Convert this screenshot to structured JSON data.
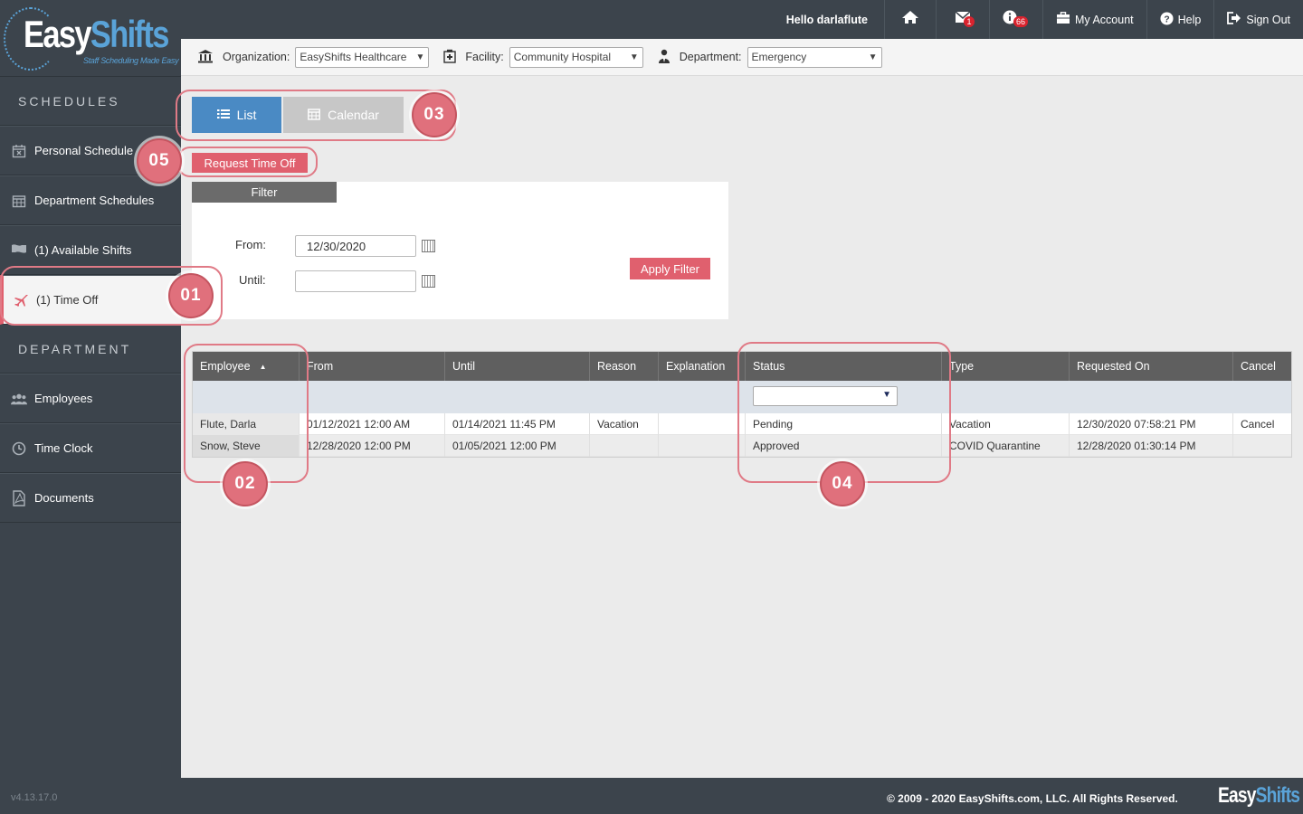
{
  "logo": {
    "word1": "Easy",
    "word2": "Shifts",
    "tagline": "Staff Scheduling Made Easy"
  },
  "sidebar": {
    "sections": [
      {
        "title": "SCHEDULES",
        "items": [
          {
            "label": "Personal Schedule",
            "icon": "calendar-x-icon"
          },
          {
            "label": "Department Schedules",
            "icon": "calendar-grid-icon"
          },
          {
            "label": "(1) Available Shifts",
            "icon": "flag-icon"
          },
          {
            "label": "(1) Time Off",
            "icon": "airplane-icon",
            "active": true
          }
        ]
      },
      {
        "title": "DEPARTMENT",
        "items": [
          {
            "label": "Employees",
            "icon": "users-icon"
          },
          {
            "label": "Time Clock",
            "icon": "clock-icon"
          },
          {
            "label": "Documents",
            "icon": "pdf-document-icon"
          }
        ]
      }
    ],
    "version": "v4.13.17.0"
  },
  "topbar": {
    "greeting": "Hello darlaflute",
    "messages_badge": "1",
    "info_badge": "66",
    "my_account": "My Account",
    "help": "Help",
    "sign_out": "Sign Out"
  },
  "orgbar": {
    "organization_label": "Organization:",
    "organization_value": "EasyShifts Healthcare",
    "facility_label": "Facility:",
    "facility_value": "Community Hospital",
    "department_label": "Department:",
    "department_value": "Emergency"
  },
  "view": {
    "list_label": "List",
    "calendar_label": "Calendar"
  },
  "request_time_off": "Request Time Off",
  "filter": {
    "title": "Filter",
    "from_label": "From:",
    "from_value": "12/30/2020",
    "until_label": "Until:",
    "until_value": "",
    "apply_label": "Apply Filter"
  },
  "grid": {
    "columns": [
      "Employee",
      "From",
      "Until",
      "Reason",
      "Explanation",
      "Status",
      "Type",
      "Requested On",
      "Cancel"
    ],
    "sort_indicator": "▲",
    "status_filter_value": "",
    "rows": [
      [
        "Flute, Darla",
        "01/12/2021 12:00 AM",
        "01/14/2021 11:45 PM",
        "Vacation",
        "",
        "Pending",
        "Vacation",
        "12/30/2020 07:58:21 PM",
        "Cancel"
      ],
      [
        "Snow, Steve",
        "12/28/2020 12:00 PM",
        "01/05/2021 12:00 PM",
        "",
        "",
        "Approved",
        "COVID Quarantine",
        "12/28/2020 01:30:14 PM",
        ""
      ]
    ]
  },
  "annotations": [
    "01",
    "02",
    "03",
    "04",
    "05"
  ],
  "footer": {
    "copyright": "© 2009 - 2020 EasyShifts.com, LLC. All Rights Reserved.",
    "logo1": "Easy",
    "logo2": "Shifts"
  },
  "colors": {
    "sidebar": "#3c444c",
    "accent": "#e0606e",
    "primary": "#4a8ac4"
  }
}
